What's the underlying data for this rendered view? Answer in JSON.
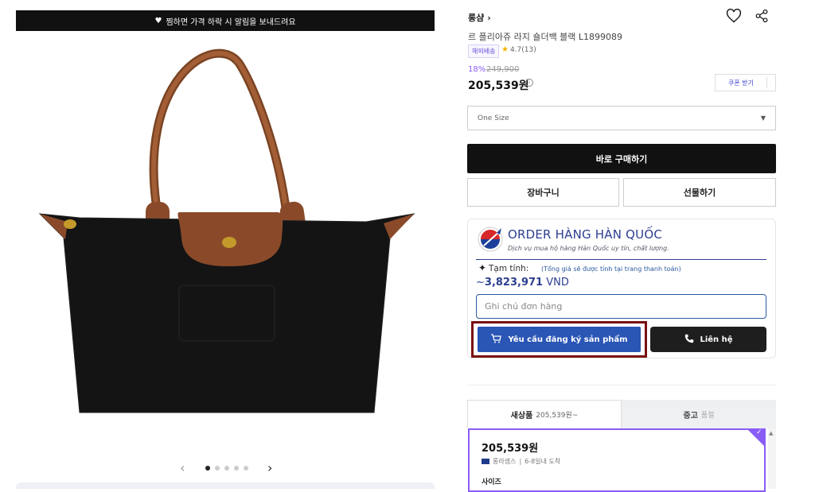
{
  "banner": {
    "icon": "heart-icon",
    "text": "찜하면 가격 하락 시 알림을 보내드려요"
  },
  "gallery": {
    "dot_count": 5,
    "active_index": 0,
    "prev": "‹",
    "next": "›"
  },
  "product": {
    "brand": "롱샴",
    "name": "르 플리아쥬 라지 숄더백 블랙 L1899089",
    "shipping_badge": "해외배송",
    "rating": "4.7(13)",
    "discount": "18%",
    "original_price": "249,900",
    "price": "205,539원",
    "coupon_label": "쿠폰 받기"
  },
  "options": {
    "size_selected": "One Size"
  },
  "actions": {
    "buy_now": "바로 구매하기",
    "cart": "장바구니",
    "gift": "선물하기"
  },
  "order_widget": {
    "title": "ORDER HÀNG HÀN QUỐC",
    "subtitle": "Dịch vụ mua hộ hàng Hàn Quốc uy tín, chất lượng.",
    "estimate_label": "Tạm tính:",
    "estimate_note": "(Tổng giá sẽ được tính tại trang thanh toán)",
    "estimate_prefix": "~",
    "estimate_amount": "3,823,971",
    "estimate_currency": "VND",
    "note_placeholder": "Ghi chú đơn hàng",
    "request_button": "Yêu cầu đăng ký sản phẩm",
    "contact_button": "Liên hệ"
  },
  "tabs": {
    "new_label": "새상품",
    "new_price": "205,539원~",
    "used_label": "중고",
    "used_status": "품절"
  },
  "option_card": {
    "price": "205,539원",
    "seller": "롱라셈스",
    "delivery": "6-8일내 도착",
    "size_label": "사이즈"
  },
  "colors": {
    "accent_purple": "#8a5cf6",
    "order_blue": "#2a56b5",
    "highlight_red": "#7a0f10"
  }
}
